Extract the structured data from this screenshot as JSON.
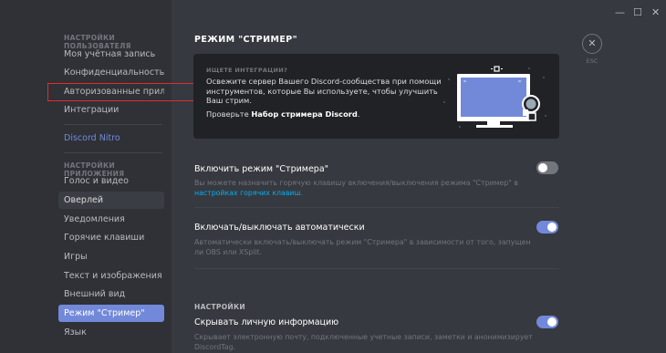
{
  "window": {
    "minimize_glyph": "—",
    "maximize_glyph": "☐",
    "close_glyph": "✕"
  },
  "sidebar": {
    "user_settings_header": "НАСТРОЙКИ ПОЛЬЗОВАТЕЛЯ",
    "user_items": [
      {
        "label": "Моя учётная запись"
      },
      {
        "label": "Конфиденциальность ..."
      },
      {
        "label": "Авторизованные прил..."
      },
      {
        "label": "Интеграции"
      }
    ],
    "nitro_label": "Discord Nitro",
    "app_settings_header": "НАСТРОЙКИ ПРИЛОЖЕНИЯ",
    "app_items": [
      {
        "label": "Голос и видео"
      },
      {
        "label": "Оверлей"
      },
      {
        "label": "Уведомления"
      },
      {
        "label": "Горячие клавиши"
      },
      {
        "label": "Игры"
      },
      {
        "label": "Текст и изображения"
      },
      {
        "label": "Внешний вид"
      },
      {
        "label": "Режим \"Стример\""
      },
      {
        "label": "Язык"
      }
    ]
  },
  "main": {
    "title": "РЕЖИМ \"СТРИМЕР\"",
    "esc_label": "ESC",
    "close_icon": "close-icon",
    "card": {
      "header": "ИЩЕТЕ ИНТЕГРАЦИИ?",
      "description": "Освежите сервер Вашего Discord-сообщества при помощи инструментов, которые Вы используете, чтобы улучшить Ваш стрим.",
      "link_prefix": "Проверьте ",
      "link_text": "Набор стримера Discord",
      "link_suffix": "."
    },
    "streamer_toggle": {
      "label": "Включить режим \"Стримера\"",
      "desc_prefix": "Вы можете назначить горячую клавишу включения/выключения режима \"Стример\" в ",
      "desc_link": "настройках горячих клавиш",
      "desc_suffix": ".",
      "state": "off"
    },
    "auto_toggle": {
      "label": "Включать/выключать автоматически",
      "description": "Автоматически включать/выключать режим \"Стримера\" в зависимости от того, запущен ли OBS или XSplit.",
      "state": "on"
    },
    "settings_header": "НАСТРОЙКИ",
    "hide_info_toggle": {
      "label": "Скрывать личную информацию",
      "description": "Скрывает электронную почту, подключенные учетные записи, заметки и анонимизирует DiscordTag.",
      "state": "on"
    },
    "colors": {
      "accent": "#7289da",
      "link": "#00b0f4",
      "highlight_box": "#e02d2d"
    }
  }
}
